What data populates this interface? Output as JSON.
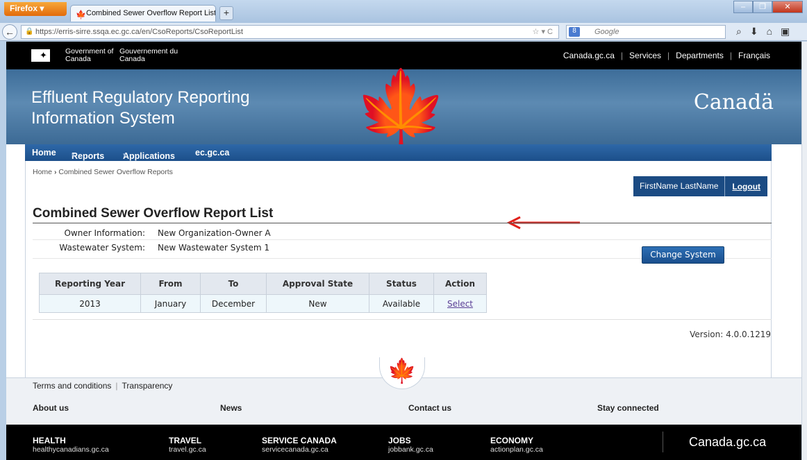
{
  "browser": {
    "menu_button": "Firefox",
    "tab_title": "Combined Sewer Overflow Report List - ...",
    "new_tab": "+",
    "url": "https://erris-sirre.ssqa.ec.gc.ca/en/CsoReports/CsoReportList",
    "search_engine": "Google",
    "window_controls": [
      "–",
      "❐",
      "✕"
    ]
  },
  "gov_bar": {
    "gov_en": "Government of Canada",
    "gov_fr": "Gouvernement du Canada",
    "links": [
      "Canada.gc.ca",
      "Services",
      "Departments",
      "Français"
    ]
  },
  "banner": {
    "title_line1": "Effluent Regulatory Reporting",
    "title_line2": "Information System",
    "wordmark": "Canadä"
  },
  "menu": [
    {
      "label": "Home",
      "dropdown": false
    },
    {
      "label": "Reports",
      "dropdown": true
    },
    {
      "label": "Applications",
      "dropdown": true
    },
    {
      "label": "ec.gc.ca",
      "dropdown": false
    }
  ],
  "breadcrumb": {
    "home": "Home",
    "sep": "›",
    "current": "Combined Sewer Overflow Reports"
  },
  "user": {
    "name": "FirstName LastName",
    "logout": "Logout"
  },
  "page_title": "Combined Sewer Overflow Report List",
  "info": [
    {
      "label": "Owner Information:",
      "value": "New Organization-Owner A"
    },
    {
      "label": "Wastewater System:",
      "value": "New Wastewater System 1"
    }
  ],
  "change_system_button": "Change System",
  "table": {
    "headers": [
      "Reporting Year",
      "From",
      "To",
      "Approval State",
      "Status",
      "Action"
    ],
    "rows": [
      [
        "2013",
        "January",
        "December",
        "New",
        "Available",
        "Select"
      ]
    ]
  },
  "version": "Version: 4.0.0.1219",
  "footer": {
    "links": [
      "Terms and conditions",
      "Transparency"
    ],
    "sections": [
      "About us",
      "News",
      "Contact us",
      "Stay connected"
    ],
    "bottom": [
      {
        "title": "HEALTH",
        "sub": "healthycanadians.gc.ca"
      },
      {
        "title": "TRAVEL",
        "sub": "travel.gc.ca"
      },
      {
        "title": "SERVICE CANADA",
        "sub": "servicecanada.gc.ca"
      },
      {
        "title": "JOBS",
        "sub": "jobbank.gc.ca"
      },
      {
        "title": "ECONOMY",
        "sub": "actionplan.gc.ca"
      }
    ],
    "brand": "Canada.gc.ca"
  },
  "colors": {
    "accent": "#1b4b83",
    "leaf": "#d52b1e",
    "arrow": "#e0201a"
  }
}
